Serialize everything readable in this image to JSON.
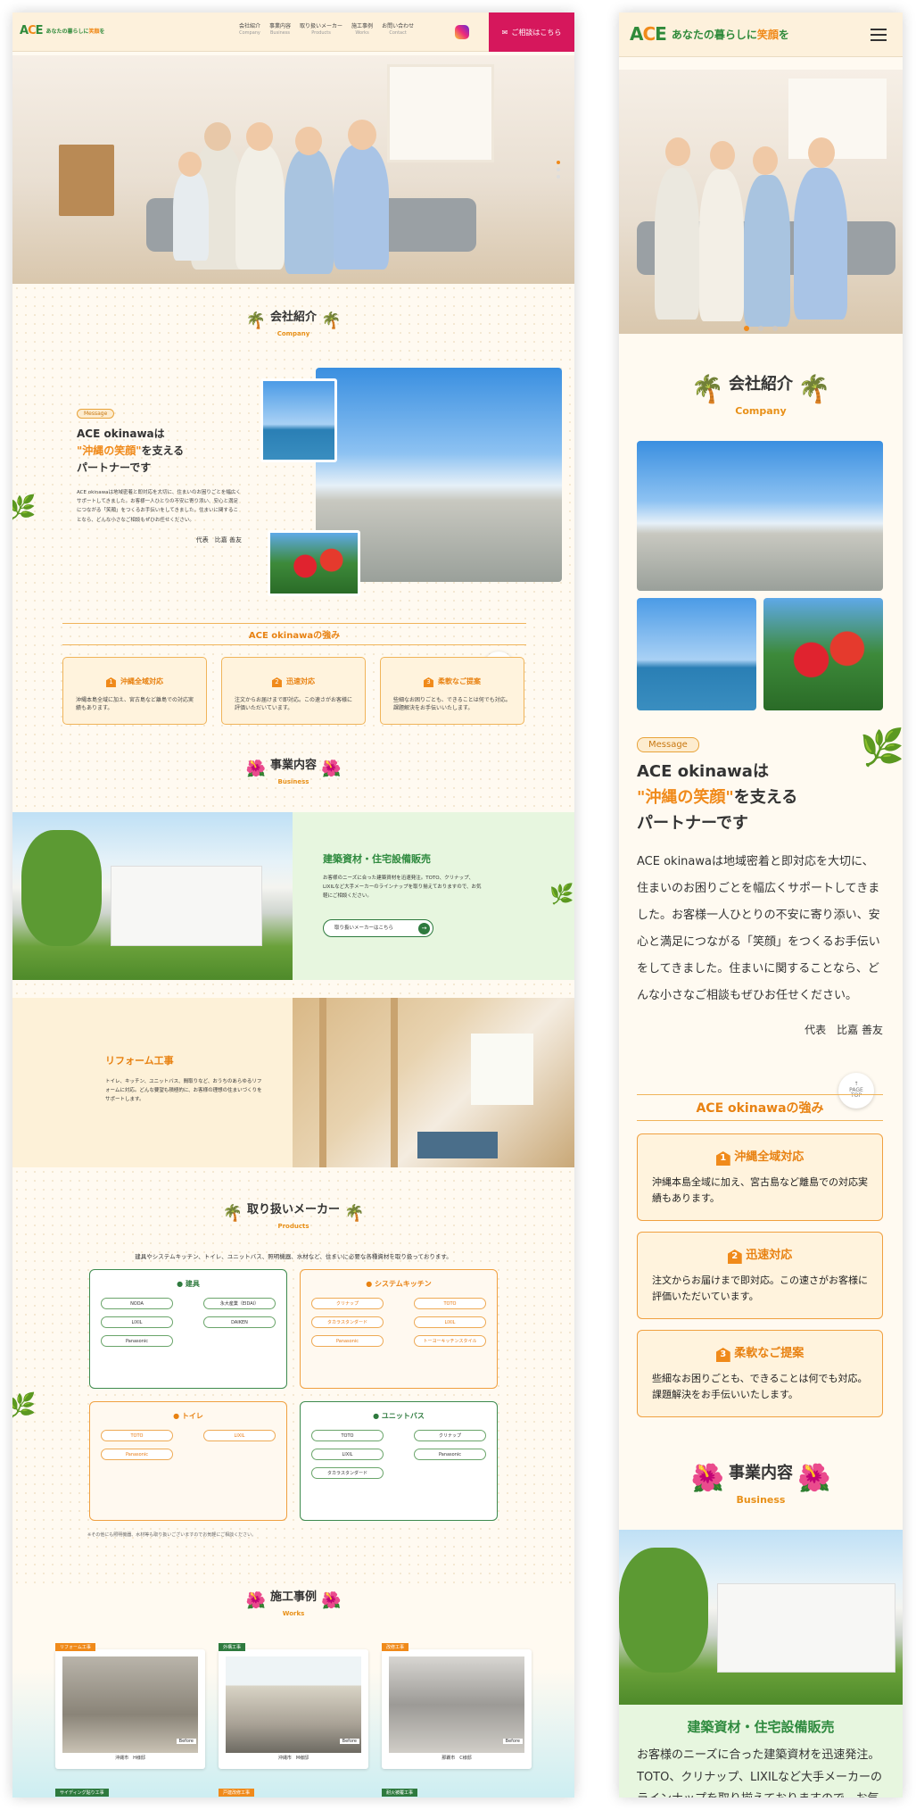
{
  "brand": {
    "tagline_pre": "あなたの暮らしに",
    "tagline_accent": "笑顔",
    "tagline_post": "を"
  },
  "nav": [
    {
      "ja": "会社紹介",
      "en": "Company"
    },
    {
      "ja": "事業内容",
      "en": "Business"
    },
    {
      "ja": "取り扱いメーカー",
      "en": "Products"
    },
    {
      "ja": "施工事例",
      "en": "Works"
    },
    {
      "ja": "お問い合わせ",
      "en": "Contact"
    }
  ],
  "consult_label": "ご相談はこちら",
  "company": {
    "title": "会社紹介",
    "sub": "Company",
    "badge": "Message",
    "head_l1": "ACE okinawaは",
    "head_accent": "\"沖縄の笑顔\"",
    "head_l2": "を支える",
    "head_l3": "パートナーです",
    "body": "ACE okinawaは地域密着と即対応を大切に、住まいのお困りごとを幅広くサポートしてきました。お客様一人ひとりの不安に寄り添い、安心と満足につながる「笑顔」をつくるお手伝いをしてきました。住まいに関することなら、どんな小さなご相談もぜひお任せください。",
    "sign_role": "代表",
    "sign_name": "比嘉 善友"
  },
  "strengths": {
    "title": "ACE okinawaの強み",
    "items": [
      {
        "num": "1",
        "title": "沖縄全域対応",
        "text": "沖縄本島全域に加え、宮古島など離島での対応実績もあります。"
      },
      {
        "num": "2",
        "title": "迅速対応",
        "text": "注文からお届けまで即対応。この速さがお客様に評価いただいています。"
      },
      {
        "num": "3",
        "title": "柔軟なご提案",
        "text": "些細なお困りごとも、できることは何でも対応。課題解決をお手伝いいたします。"
      }
    ]
  },
  "pagetop": {
    "arrow": "↑",
    "l1": "PAGE",
    "l2": "TOP"
  },
  "business": {
    "title": "事業内容",
    "sub": "Business",
    "b1_title": "建築資材・住宅設備販売",
    "b1_text": "お客様のニーズに合った建築資材を迅速発注。TOTO、クリナップ、LIXILなど大手メーカーのラインナップを取り揃えておりますので、お気軽にご相談ください。",
    "b1_btn": "取り扱いメーカーはこちら",
    "b2_title": "リフォーム工事",
    "b2_text": "トイレ、キッチン、ユニットバス、間取りなど、おうちのあらゆるリフォームに対応。どんな要望も積極的に、お客様の理想の住まいづくりをサポートします。"
  },
  "makers": {
    "title": "取り扱いメーカー",
    "sub": "Products",
    "intro": "建具やシステムキッチン、トイレ、ユニットバス、照明機器、水材など、住まいに必要な各種資材を取り扱っております。",
    "groups": [
      {
        "name": "建具",
        "items": [
          "NODA",
          "永大産業（EIDAI）",
          "LIXIL",
          "DAIKEN",
          "Panasonic"
        ]
      },
      {
        "name": "システムキッチン",
        "items": [
          "クリナップ",
          "TOTO",
          "タカラスタンダード",
          "LIXIL",
          "Panasonic",
          "トーヨーキッチンスタイル"
        ]
      },
      {
        "name": "トイレ",
        "items": [
          "TOTO",
          "LIXIL",
          "Panasonic"
        ]
      },
      {
        "name": "ユニットバス",
        "items": [
          "TOTO",
          "クリナップ",
          "LIXIL",
          "Panasonic",
          "タカラスタンダード"
        ]
      }
    ],
    "note": "※その他にも照明機器、水材等も取り扱いございますのでお気軽にご相談ください。"
  },
  "works": {
    "title": "施工事例",
    "sub": "Works",
    "items": [
      {
        "tag": "リフォーム工事",
        "place": "沖縄市　H様邸",
        "label": "Before",
        "color": "#f08a1a"
      },
      {
        "tag": "外構工事",
        "place": "沖縄市　M様邸",
        "label": "Before",
        "color": "#2e7a3e"
      },
      {
        "tag": "改修工事",
        "place": "那覇市　C様邸",
        "label": "Before",
        "color": "#f08a1a"
      }
    ],
    "row2": [
      "サイディング貼り工事",
      "戸建改修工事",
      "耐火被覆工事"
    ]
  },
  "colors": {
    "accent": "#f08a1a",
    "green": "#2e7a3e",
    "consult": "#d6175c"
  }
}
